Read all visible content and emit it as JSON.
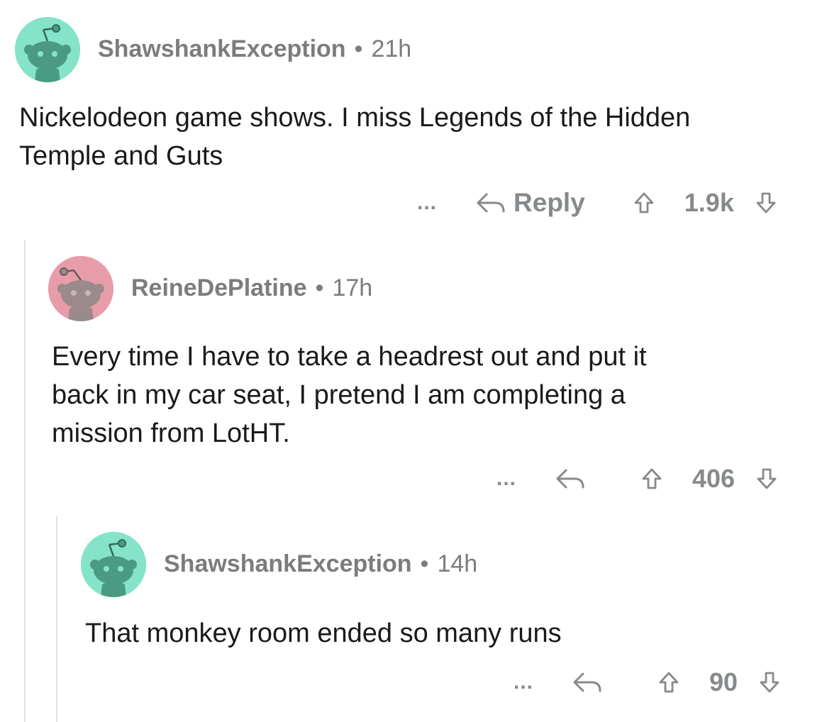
{
  "colors": {
    "teal_avatar": "#84e3c8",
    "pink_avatar": "#e89ca9",
    "meta_gray": "#7c7c7c",
    "action_gray": "#878a8c",
    "thread_line": "#e2e2e2"
  },
  "comments": [
    {
      "username": "ShawshankException",
      "separator": "•",
      "age": "21h",
      "body_lines": [
        "Nickelodeon game shows. I miss Legends of the Hidden",
        "Temple and Guts"
      ],
      "more": "...",
      "reply_label": "Reply",
      "score": "1.9k",
      "avatar_icon": "snoo-avatar-icon"
    },
    {
      "username": "ReineDePlatine",
      "separator": "•",
      "age": "17h",
      "body_lines": [
        "Every time I have to take a headrest out and put it",
        "back in my car seat, I pretend I am completing a",
        "mission from LotHT."
      ],
      "more": "...",
      "score": "406",
      "avatar_icon": "snoo-avatar-icon"
    },
    {
      "username": "ShawshankException",
      "separator": "•",
      "age": "14h",
      "body_lines": [
        "That monkey room ended so many runs"
      ],
      "more": "...",
      "score": "90",
      "avatar_icon": "snoo-avatar-icon"
    }
  ]
}
